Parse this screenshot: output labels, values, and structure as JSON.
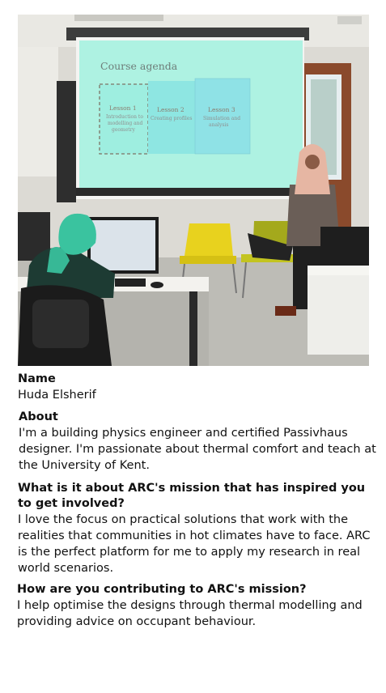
{
  "photo": {
    "slide": {
      "title": "Course agenda",
      "lessons": [
        {
          "heading": "Lesson 1",
          "text": [
            "Introduction to",
            "modelling and",
            "geometry"
          ]
        },
        {
          "heading": "Lesson 2",
          "text": [
            "Creating profiles"
          ]
        },
        {
          "heading": "Lesson 3",
          "text": [
            "Simulation and",
            "analysis"
          ]
        }
      ]
    }
  },
  "profile": {
    "name_label": "Name",
    "name": "Huda Elsherif",
    "about_label": "About",
    "about": "I'm a building physics engineer and certified Passivhaus designer. I'm passionate about thermal comfort and teach at the University of Kent.",
    "q1_label": "What is it about ARC's mission that has inspired you to get involved?",
    "q1_answer": "I love the focus on practical solutions that work with the realities that communities in hot climates have to face. ARC is the perfect platform for me to apply my research in real world scenarios.",
    "q2_label": "How are you contributing to ARC's mission?",
    "q2_answer": "I help optimise the designs through thermal modelling and providing advice on occupant behaviour."
  }
}
